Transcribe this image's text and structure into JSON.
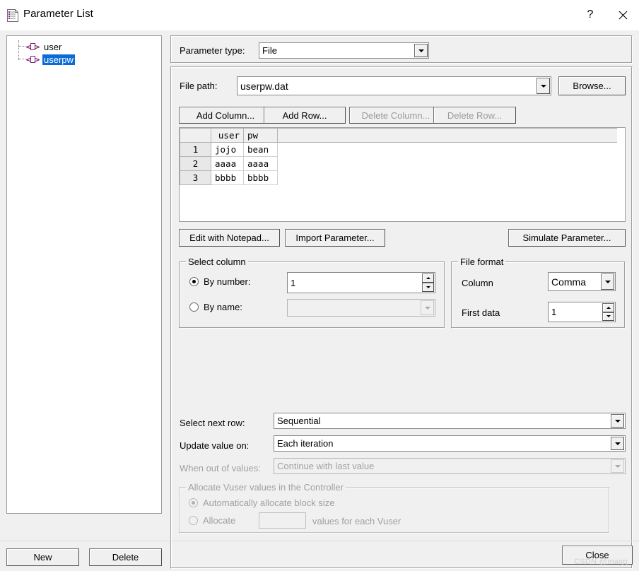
{
  "window": {
    "title": "Parameter List",
    "icon": "parameter-list-icon",
    "help_label": "?",
    "close_label": "✕"
  },
  "tree": {
    "items": [
      {
        "label": "user",
        "selected": false,
        "icon": "parameter-icon"
      },
      {
        "label": "userpw",
        "selected": true,
        "icon": "parameter-icon"
      }
    ]
  },
  "left_buttons": {
    "new_label": "New",
    "delete_label": "Delete"
  },
  "parameter_type": {
    "label": "Parameter type:",
    "value": "File"
  },
  "file_path": {
    "label": "File path:",
    "value": "userpw.dat",
    "browse_label": "Browse..."
  },
  "table_buttons": {
    "add_column": "Add Column...",
    "add_row": "Add Row...",
    "delete_column": "Delete Column...",
    "delete_row": "Delete Row..."
  },
  "grid": {
    "columns": [
      "user",
      "pw"
    ],
    "rows": [
      {
        "index": "1",
        "cells": [
          "jojo",
          "bean"
        ]
      },
      {
        "index": "2",
        "cells": [
          "aaaa",
          "aaaa"
        ]
      },
      {
        "index": "3",
        "cells": [
          "bbbb",
          "bbbb"
        ]
      }
    ]
  },
  "action_buttons": {
    "edit_notepad": "Edit with Notepad...",
    "import_parameter": "Import Parameter...",
    "simulate_parameter": "Simulate Parameter..."
  },
  "select_column": {
    "caption": "Select column",
    "by_number_label": "By number:",
    "by_number_selected": true,
    "by_number_value": "1",
    "by_name_label": "By name:",
    "by_name_selected": false,
    "by_name_value": ""
  },
  "file_format": {
    "caption": "File format",
    "column_label": "Column",
    "column_value": "Comma",
    "first_data_label": "First data",
    "first_data_value": "1"
  },
  "row_options": {
    "select_next_row_label": "Select next row:",
    "select_next_row_value": "Sequential",
    "update_value_on_label": "Update value on:",
    "update_value_on_value": "Each iteration",
    "when_out_of_values_label": "When out of values:",
    "when_out_of_values_value": "Continue with last value",
    "when_out_of_values_disabled": true
  },
  "allocate": {
    "caption": "Allocate Vuser values in the Controller",
    "auto_label": "Automatically allocate block size",
    "auto_selected": true,
    "allocate_label": "Allocate",
    "allocate_value": "",
    "allocate_suffix": "values for each Vuser",
    "disabled": true
  },
  "footer": {
    "close_label": "Close",
    "watermark": "CSDN @magg"
  }
}
